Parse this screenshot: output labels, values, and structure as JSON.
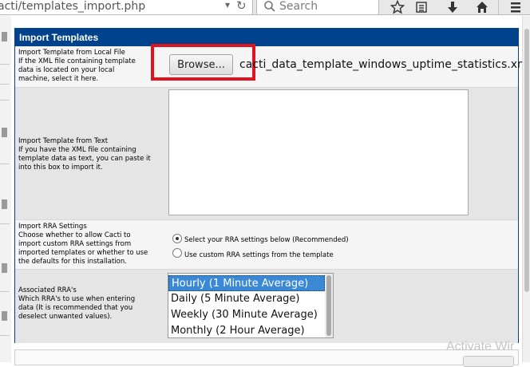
{
  "browser": {
    "url": "acti/templates_import.php",
    "search_placeholder": "Search"
  },
  "panel": {
    "title": "Import Templates"
  },
  "local_file": {
    "label": "Import Template from Local File",
    "help_lines": [
      "If the XML file containing template",
      "data is located on your local",
      "machine, select it here."
    ],
    "browse_label": "Browse...",
    "filename": "cacti_data_template_windows_uptime_statistics.xml"
  },
  "text_import": {
    "label": "Import Template from Text",
    "help_lines": [
      "If you have the XML file containing",
      "template data as text, you can paste it",
      "into this box to import it."
    ],
    "value": ""
  },
  "rra_settings": {
    "label": "Import RRA Settings",
    "help_lines": [
      "Choose whether to allow Cacti to",
      "import custom RRA settings from",
      "imported templates or whether to use",
      "the defaults for this installation."
    ],
    "options": [
      "Select your RRA settings below (Recommended)",
      "Use custom RRA settings from the template"
    ],
    "selected_index": 0
  },
  "associated_rras": {
    "label": "Associated RRA's",
    "help_lines": [
      "Which RRA's to use when entering",
      "data (It is recommended that you",
      "deselect unwanted values)."
    ],
    "options": [
      "Hourly (1 Minute Average)",
      "Daily (5 Minute Average)",
      "Weekly (30 Minute Average)",
      "Monthly (2 Hour Average)"
    ],
    "selected": "Hourly (1 Minute Average)"
  },
  "watermark": "Activate Wir",
  "colors": {
    "header_blue": "#00438c",
    "highlight": "#e0141e",
    "selection": "#3a88d6"
  }
}
